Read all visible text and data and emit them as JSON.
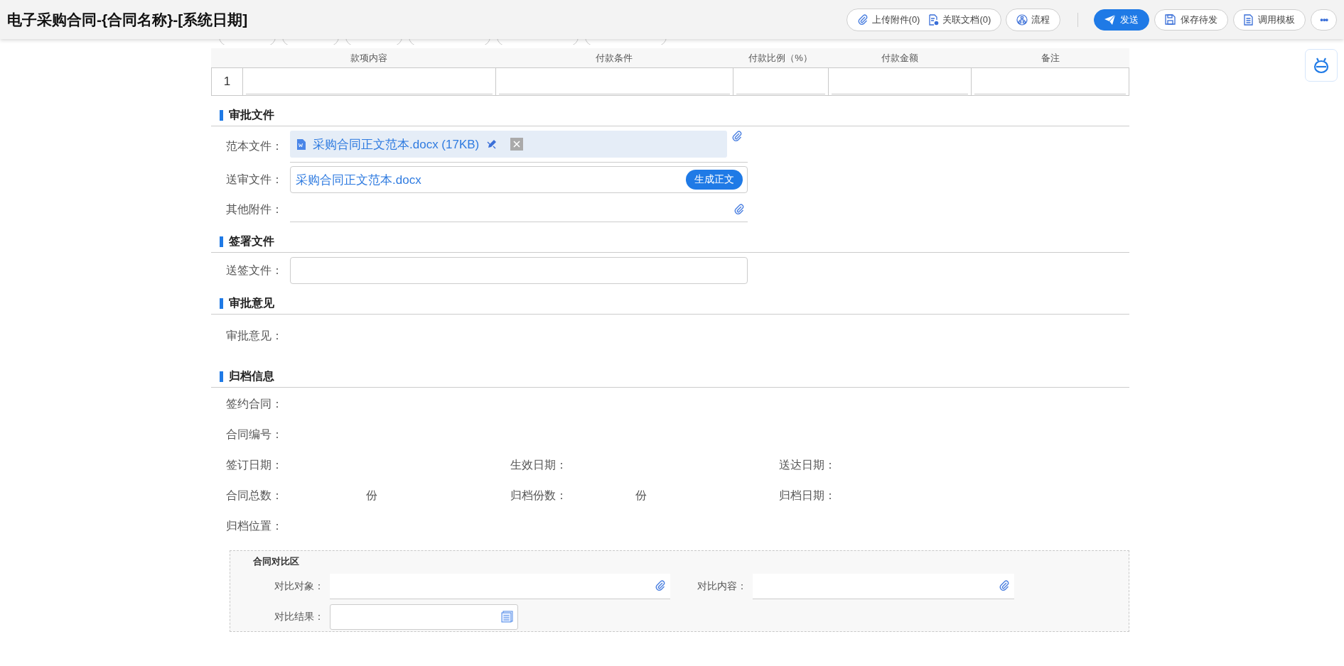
{
  "title": "电子采购合同-{合同名称}-[系统日期]",
  "action_groups": [
    [
      {
        "label": "上传附件(0)"
      },
      {
        "label": "关联文档(0)"
      }
    ],
    [
      {
        "label": "流程"
      }
    ]
  ],
  "buttons": [
    {
      "label": "发送",
      "kind": "primary"
    },
    {
      "label": "保存待发",
      "kind": "default"
    },
    {
      "label": "调用模板",
      "kind": "default"
    },
    {
      "label": "•••",
      "kind": "more"
    }
  ],
  "payment_table": {
    "columns": [
      "款项内容",
      "付款条件",
      "付款比例（%）",
      "付款金额",
      "备注"
    ],
    "rows": [
      {
        "index": "1"
      }
    ]
  },
  "sections": [
    {
      "title": "审批文件",
      "fields": [
        {
          "kind": "chip",
          "label": "范本文件：",
          "value": "采购合同正文范本.docx (17KB)"
        },
        {
          "kind": "link",
          "label": "送审文件：",
          "value": "采购合同正文范本.docx",
          "button": "生成正文"
        },
        {
          "kind": "attach",
          "label": "其他附件："
        }
      ]
    },
    {
      "title": "签署文件",
      "fields": [
        {
          "kind": "box",
          "label": "送签文件："
        }
      ]
    },
    {
      "title": "审批意见",
      "fields": [
        {
          "kind": "text",
          "label": "审批意见："
        }
      ]
    }
  ],
  "archive": {
    "title": "归档信息",
    "rows": [
      [
        {
          "label": "签约合同："
        }
      ],
      [
        {
          "label": "合同编号："
        }
      ],
      [
        {
          "label": "签订日期："
        },
        {
          "label": "生效日期："
        },
        {
          "label": "送达日期："
        }
      ],
      [
        {
          "label": "合同总数：",
          "unit": "份"
        },
        {
          "label": "归档份数：",
          "unit": "份"
        },
        {
          "label": "归档日期："
        }
      ],
      [
        {
          "label": "归档位置："
        }
      ]
    ]
  },
  "compare": {
    "title": "合同对比区",
    "fields": [
      {
        "kind": "attach",
        "label": "对比对象："
      },
      {
        "kind": "attach",
        "label": "对比内容："
      },
      {
        "kind": "result",
        "label": "对比结果："
      }
    ]
  }
}
